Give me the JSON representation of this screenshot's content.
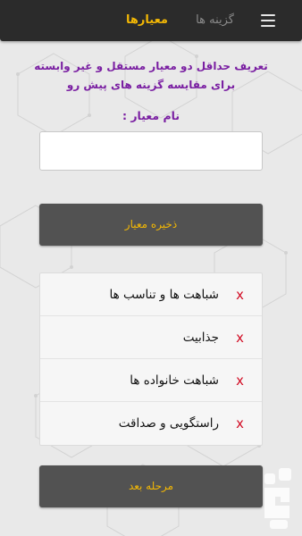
{
  "header": {
    "tab_criteria": "معیارها",
    "tab_options": "گزینه ها"
  },
  "intro": {
    "line1": "تعریف حداقل دو معیار مستقل و غیر وابسته",
    "line2": "برای مقایسه گزینه های پیش رو"
  },
  "form": {
    "name_label": "نام معیار :",
    "name_value": "",
    "save_label": "ذخیره معیار"
  },
  "criteria": [
    {
      "label": "شباهت ها و تناسب ها",
      "delete": "x"
    },
    {
      "label": "جذابیت",
      "delete": "x"
    },
    {
      "label": "شباهت خانواده ها",
      "delete": "x"
    },
    {
      "label": "راستگویی و صداقت",
      "delete": "x"
    }
  ],
  "footer": {
    "next_label": "مرحله بعد"
  },
  "colors": {
    "topbar": "#2b2b2b",
    "accent": "#f2b705",
    "intro_text": "#7a1fa2",
    "delete": "#d0021b",
    "button": "#525252"
  },
  "icons": {
    "menu": "hamburger-icon",
    "logo": "bazaar-logo"
  }
}
